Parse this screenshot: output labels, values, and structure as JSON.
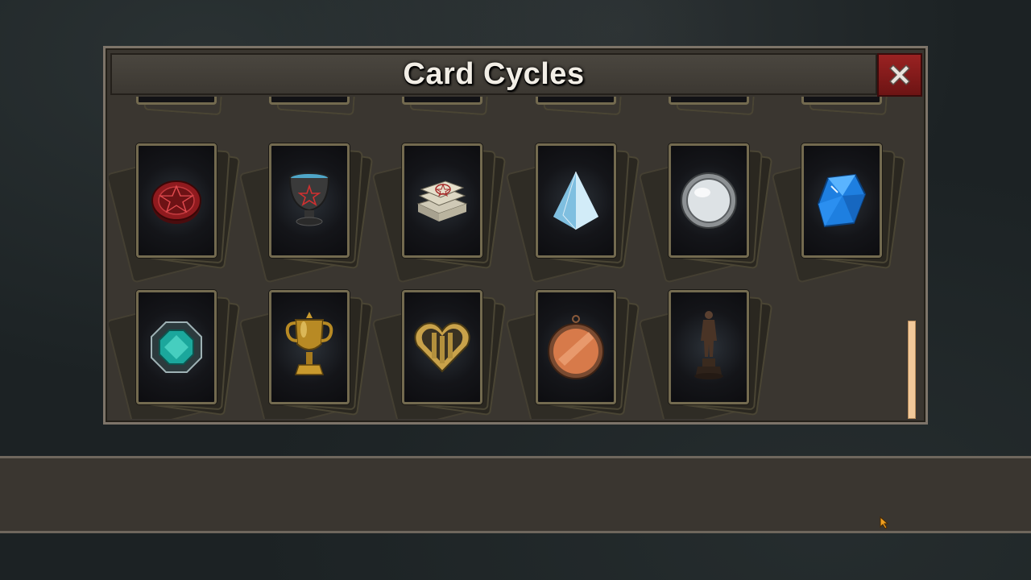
{
  "dialog": {
    "title": "Card Cycles",
    "close_icon": "close-x-icon"
  },
  "cards_row_partial": [
    {
      "name": "card-partial-1"
    },
    {
      "name": "card-partial-2"
    },
    {
      "name": "card-partial-3"
    },
    {
      "name": "card-partial-4"
    },
    {
      "name": "card-partial-5"
    },
    {
      "name": "card-partial-6"
    }
  ],
  "cards": [
    {
      "icon": "pentagram-seal-icon"
    },
    {
      "icon": "pentagram-cauldron-icon"
    },
    {
      "icon": "pentagram-papers-icon"
    },
    {
      "icon": "crystal-pyramid-icon"
    },
    {
      "icon": "silver-mirror-icon"
    },
    {
      "icon": "blue-gem-icon"
    },
    {
      "icon": "octagon-emerald-icon"
    },
    {
      "icon": "golden-trophy-icon"
    },
    {
      "icon": "metal-heart-icon"
    },
    {
      "icon": "copper-medal-icon"
    },
    {
      "icon": "bronze-statue-icon"
    }
  ],
  "colors": {
    "panel": "#3a3630",
    "card_border": "#736a4f",
    "close_red": "#8a1c1c",
    "scroll_thumb": "#f2c99a"
  }
}
